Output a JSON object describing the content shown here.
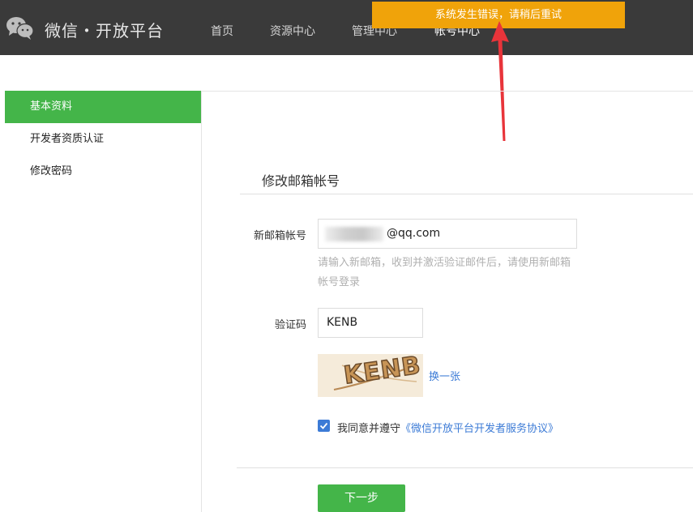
{
  "header": {
    "brand": "微信・开放平台",
    "nav": [
      "首页",
      "资源中心",
      "管理中心",
      "帐号中心"
    ],
    "active_nav": "帐号中心"
  },
  "error_banner": {
    "text": "系统发生错误，请稍后重试",
    "color": "#f0a30a"
  },
  "sidebar": {
    "items": [
      {
        "label": "基本资料",
        "active": true
      },
      {
        "label": "开发者资质认证",
        "active": false
      },
      {
        "label": "修改密码",
        "active": false
      }
    ]
  },
  "form": {
    "title": "修改邮箱帐号",
    "email_label": "新邮箱帐号",
    "email_value": "@qq.com",
    "email_hint": "请输入新邮箱，收到并激活验证邮件后，请使用新邮箱帐号登录",
    "captcha_label": "验证码",
    "captcha_value": "KENB",
    "captcha_image_text": "KENB",
    "refresh_label": "换一张",
    "agree_text": "我同意并遵守",
    "agreement_link": "《微信开放平台开发者服务协议》",
    "agree_checked": true,
    "next_button": "下一步"
  },
  "colors": {
    "accent": "#44b549",
    "link": "#3c7bd6",
    "header_bg": "#3a3a3a",
    "arrow": "#e8343a"
  },
  "icons": {
    "logo": "wechat-logo-icon",
    "checkbox": "checkmark-icon",
    "arrow": "red-arrow-icon"
  }
}
